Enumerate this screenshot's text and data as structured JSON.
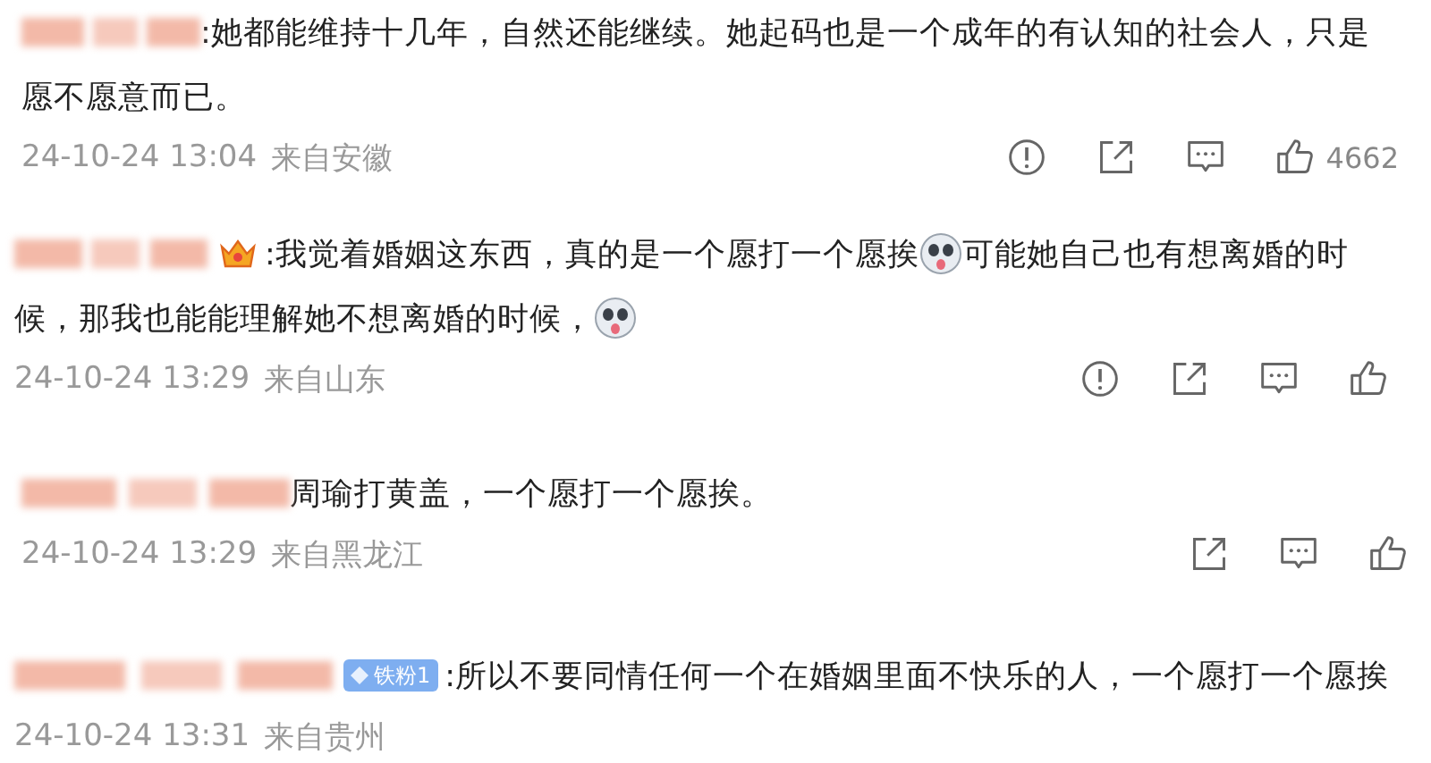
{
  "comments": [
    {
      "crown": false,
      "lines": [
        [
          {
            "kind": "text",
            "text": ":她都能维持十几年，自然还能继续。她起码也是一个成年的有认知的社会人，只是"
          }
        ],
        [
          {
            "kind": "text",
            "text": "愿不愿意而已。"
          }
        ]
      ],
      "time": "24-10-24 13:04",
      "location": "来自安徽",
      "actions": [
        {
          "kind": "report"
        },
        {
          "kind": "share"
        },
        {
          "kind": "comment"
        },
        {
          "kind": "like",
          "count": "4662"
        }
      ]
    },
    {
      "crown": true,
      "lines": [
        [
          {
            "kind": "text",
            "text": ":我觉着婚姻这东西，真的是一个愿打一个愿挨"
          },
          {
            "kind": "emoji"
          },
          {
            "kind": "text",
            "text": "可能她自己也有想离婚的时"
          }
        ],
        [
          {
            "kind": "text",
            "text": "候，那我也能能理解她不想离婚的时候，"
          },
          {
            "kind": "emoji"
          }
        ]
      ],
      "time": "24-10-24 13:29",
      "location": "来自山东",
      "actions": [
        {
          "kind": "report"
        },
        {
          "kind": "share"
        },
        {
          "kind": "comment"
        },
        {
          "kind": "like"
        }
      ]
    },
    {
      "crown": false,
      "lines": [
        [
          {
            "kind": "text",
            "text": "周瑜打黄盖，一个愿打一个愿挨。"
          }
        ]
      ],
      "time": "24-10-24 13:29",
      "location": "来自黑龙江",
      "actions": [
        {
          "kind": "share"
        },
        {
          "kind": "comment"
        },
        {
          "kind": "like"
        }
      ]
    },
    {
      "crown": false,
      "fan_badge": "铁粉1",
      "lines": [
        [
          {
            "kind": "text",
            "text": ":所以不要同情任何一个在婚姻里面不快乐的人，一个愿打一个愿挨"
          }
        ]
      ],
      "time": "24-10-24 13:31",
      "location": "来自贵州"
    }
  ]
}
